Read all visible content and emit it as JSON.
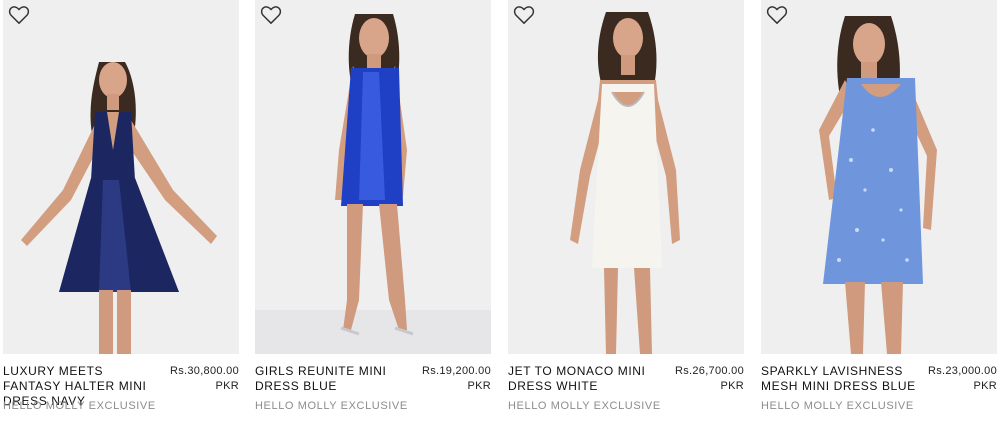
{
  "products": [
    {
      "name": "LUXURY MEETS FANTASY HALTER MINI DRESS NAVY",
      "price": "Rs.30,800.00",
      "currency": "PKR",
      "brand": "HELLO MOLLY EXCLUSIVE",
      "dress_color": "#1c2660",
      "dress_highlight": "#3a4aa0",
      "background": "#efeff0",
      "icon": "heart-outline-icon"
    },
    {
      "name": "GIRLS REUNITE MINI DRESS BLUE",
      "price": "Rs.19,200.00",
      "currency": "PKR",
      "brand": "HELLO MOLLY EXCLUSIVE",
      "dress_color": "#1f3fc4",
      "dress_highlight": "#4a6cf0",
      "background": "#efeff0",
      "icon": "heart-outline-icon"
    },
    {
      "name": "JET TO MONACO MINI DRESS WHITE",
      "price": "Rs.26,700.00",
      "currency": "PKR",
      "brand": "HELLO MOLLY EXCLUSIVE",
      "dress_color": "#f6f4ef",
      "dress_highlight": "#ffffff",
      "background": "#efeff0",
      "icon": "heart-outline-icon"
    },
    {
      "name": "SPARKLY LAVISHNESS MESH MINI DRESS BLUE",
      "price": "Rs.23,000.00",
      "currency": "PKR",
      "brand": "HELLO MOLLY EXCLUSIVE",
      "dress_color": "#6f96dc",
      "dress_highlight": "#a8c4f2",
      "background": "#efeff0",
      "icon": "heart-outline-icon"
    }
  ]
}
